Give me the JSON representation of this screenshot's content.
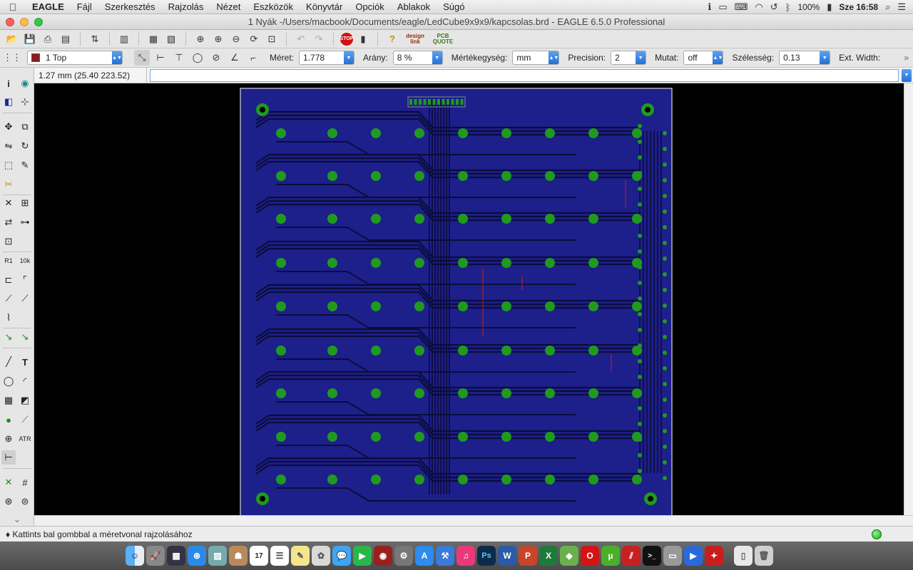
{
  "menubar": {
    "app": "EAGLE",
    "menus": [
      "Fájl",
      "Szerkesztés",
      "Rajzolás",
      "Nézet",
      "Eszközök",
      "Könyvtár",
      "Opciók",
      "Ablakok",
      "Súgó"
    ],
    "battery": "100%",
    "clock": "Sze 16:58"
  },
  "window": {
    "title": "1 Nyák -/Users/macbook/Documents/eagle/LedCube9x9x9/kapcsolas.brd - EAGLE 6.5.0 Professional"
  },
  "toolbar": {
    "logo_designlink": "design link",
    "logo_pcbquote": "PCB QUOTE",
    "stop": "STOP"
  },
  "params": {
    "layer": "1 Top",
    "meret_label": "Méret:",
    "meret_value": "1.778",
    "arany_label": "Arány:",
    "arany_value": "8 %",
    "unit_label": "Mértékegység:",
    "unit_value": "mm",
    "precision_label": "Precision:",
    "precision_value": "2",
    "mutat_label": "Mutat:",
    "mutat_value": "off",
    "szelesseg_label": "Szélesség:",
    "szelesseg_value": "0.13",
    "ext_label": "Ext. Width:"
  },
  "command": {
    "coordinates": "1.27 mm (25.40 223.52)",
    "value": ""
  },
  "status": {
    "message": "♦ Kattints bal gombbal a méretvonal rajzolásához"
  },
  "colors": {
    "board": "#1d1f8a",
    "pad": "#1f9a1f",
    "trace": "#0b0d3a",
    "border": "#ffffff",
    "airwire": "#c42020"
  },
  "dock": {
    "calendar_day": "17"
  }
}
